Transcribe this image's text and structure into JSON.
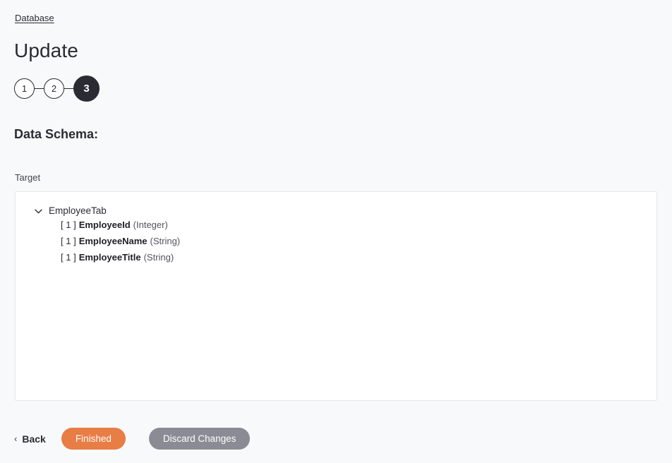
{
  "breadcrumb": {
    "label": "Database"
  },
  "page": {
    "title": "Update"
  },
  "stepper": {
    "steps": [
      {
        "label": "1",
        "state": "inactive"
      },
      {
        "label": "2",
        "state": "inactive"
      },
      {
        "label": "3",
        "state": "active"
      }
    ]
  },
  "schema": {
    "heading": "Data Schema:",
    "target_label": "Target",
    "tree": {
      "root": {
        "label": "EmployeeTab",
        "expanded": true,
        "chevron_icon": "chevron-down-icon"
      },
      "fields": [
        {
          "occurrence": "[ 1 ]",
          "name": "EmployeeId",
          "type": "(Integer)"
        },
        {
          "occurrence": "[ 1 ]",
          "name": "EmployeeName",
          "type": "(String)"
        },
        {
          "occurrence": "[ 1 ]",
          "name": "EmployeeTitle",
          "type": "(String)"
        }
      ]
    }
  },
  "footer": {
    "back_label": "Back",
    "back_icon": "chevron-left-icon",
    "finished_label": "Finished",
    "discard_label": "Discard Changes"
  },
  "colors": {
    "page_background": "#f8f9fa",
    "panel_background": "#ffffff",
    "panel_border": "#e6e7ea",
    "text_primary": "#2b2b33",
    "step_active_background": "#2b2b33",
    "primary_button": "#e87d45",
    "secondary_button": "#8b8b95"
  }
}
